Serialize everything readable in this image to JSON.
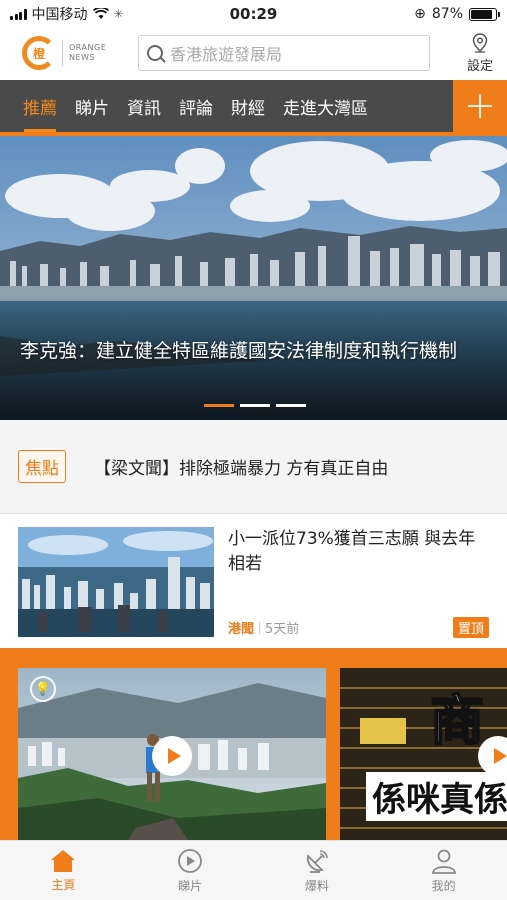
{
  "status_bar": {
    "carrier": "中国移动",
    "time": "00:29",
    "battery": "87%",
    "battery_level": 0.87
  },
  "header": {
    "logo_glyph": "橙",
    "logo_text_line1": "ORANGE",
    "logo_text_line2": "NEWS",
    "search_placeholder": "香港旅遊發展局",
    "settings_label": "設定"
  },
  "nav": {
    "tabs": [
      {
        "label": "推薦",
        "active": true
      },
      {
        "label": "睇片"
      },
      {
        "label": "資訊"
      },
      {
        "label": "評論"
      },
      {
        "label": "財經"
      },
      {
        "label": "走進大灣區"
      }
    ]
  },
  "hero": {
    "title": "李克強：建立健全特區維護國安法律制度和執行機制",
    "slide_count": 3,
    "active_slide": 0
  },
  "focus": {
    "badge": "焦點",
    "headline": "【梁文聞】排除極端暴力 方有真正自由"
  },
  "news_item": {
    "title": "小一派位73%獲首三志願 與去年相若",
    "category": "港聞",
    "time": "5天前",
    "pin_label": "置頂"
  },
  "videos": {
    "card2_text_top": "商",
    "card2_text_bottom": "係咪真係"
  },
  "bottom_tabs": [
    {
      "label": "主頁",
      "icon": "home-icon",
      "active": true
    },
    {
      "label": "睇片",
      "icon": "play-circle-icon"
    },
    {
      "label": "爆料",
      "icon": "satellite-dish-icon"
    },
    {
      "label": "我的",
      "icon": "user-icon"
    }
  ],
  "colors": {
    "accent": "#ee7d1a",
    "nav_bg": "#4a4a4a"
  }
}
